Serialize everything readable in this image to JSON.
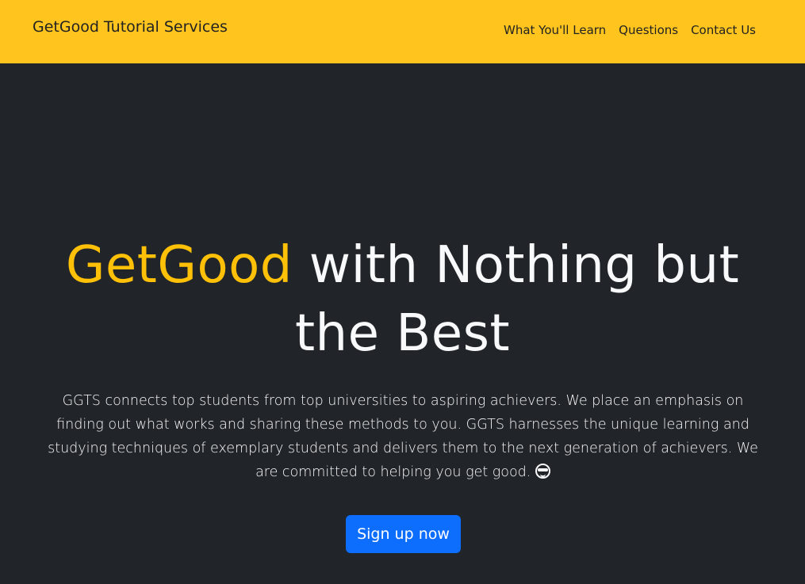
{
  "navbar": {
    "brand": "GetGood Tutorial Services",
    "links": [
      "What You'll Learn",
      "Questions",
      "Contact Us"
    ],
    "background_color": "#ffc41e"
  },
  "hero": {
    "title_accent": "GetGood",
    "title_rest": " with Nothing but the Best",
    "lead": "GGTS connects top students from top universities to aspiring achievers. We place an emphasis on finding out what works and sharing these methods to you. GGTS harnesses the unique learning and studying techniques of exemplary students and delivers them to the next generation of achievers. We are committed to helping you get good. ",
    "emoji_icon": "sunglasses-face-icon",
    "cta_label": "Sign up now",
    "accent_color": "#ffc107",
    "background_color": "#212529",
    "cta_color": "#0d6efd"
  }
}
